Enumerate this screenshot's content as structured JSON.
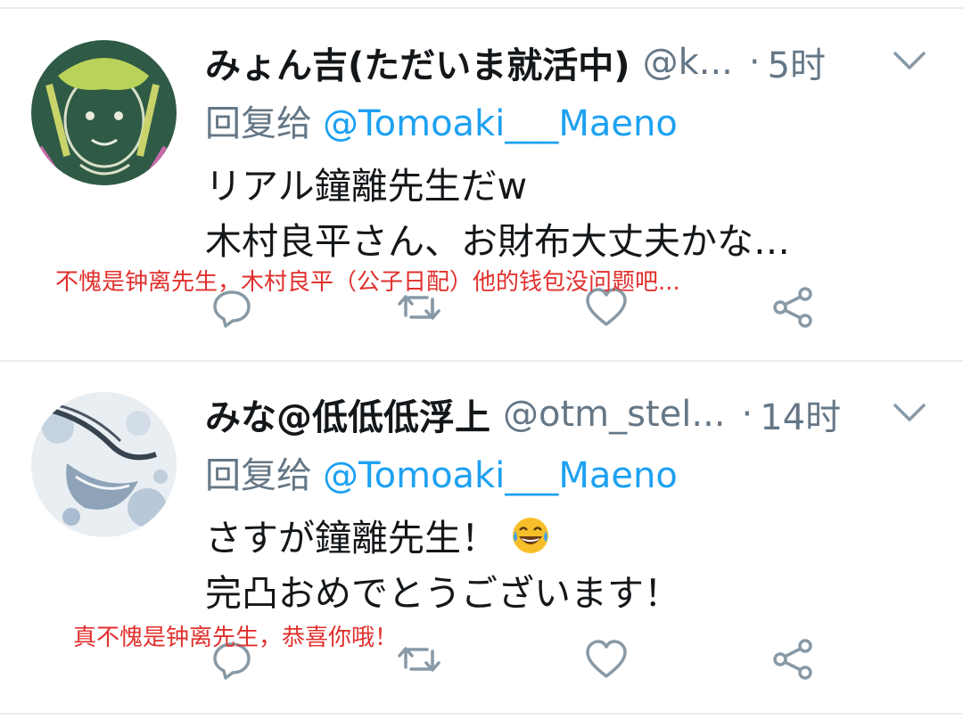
{
  "colors": {
    "text": "#14171a",
    "secondary": "#657786",
    "link": "#1da1f2",
    "annotation": "#e0302d",
    "divider": "#e6ecf0"
  },
  "tweets": [
    {
      "name": "みょん吉(ただいま就活中)",
      "handle": "@k...",
      "separator": "·",
      "time": "5时",
      "reply_label": "回复给",
      "reply_to": "@Tomoaki___Maeno",
      "lines": [
        "リアル鐘離先生だw",
        "木村良平さん、お財布大丈夫かな…"
      ],
      "annotation": "不愧是钟离先生，木村良平（公子日配）他的钱包没问题吧...",
      "avatar_icon": "chalk-drawing-avatar"
    },
    {
      "name": "みな@低低低浮上",
      "handle": "@otm_stel...",
      "separator": "·",
      "time": "14时",
      "reply_label": "回复给",
      "reply_to": "@Tomoaki___Maeno",
      "lines": [
        "さすが鐘離先生！",
        "完凸おめでとうございます！"
      ],
      "emoji": "tears-of-joy-emoji",
      "annotation": "真不愧是钟离先生，恭喜你哦！",
      "avatar_icon": "illustration-avatar"
    }
  ],
  "actions": [
    "reply-icon",
    "retweet-icon",
    "like-icon",
    "share-icon"
  ]
}
